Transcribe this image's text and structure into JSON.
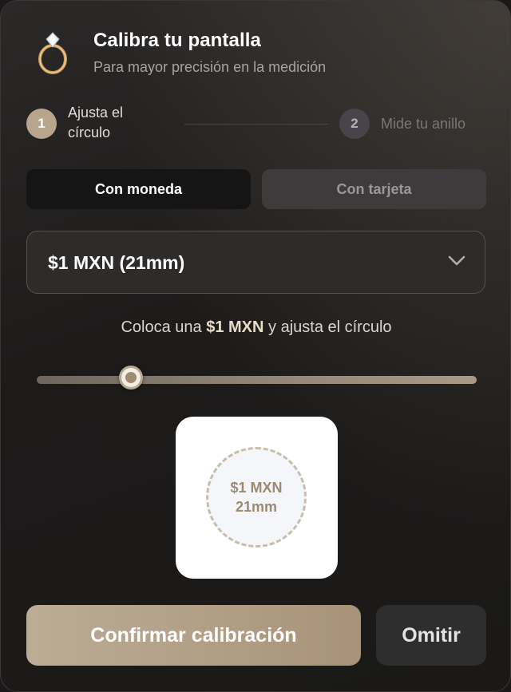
{
  "header": {
    "title": "Calibra tu pantalla",
    "subtitle": "Para mayor precisión en la medición",
    "icon": "ring-icon"
  },
  "steps": [
    {
      "number": "1",
      "label": "Ajusta el círculo",
      "state": "active"
    },
    {
      "number": "2",
      "label": "Mide tu anillo",
      "state": "inactive"
    }
  ],
  "tabs": [
    {
      "label": "Con moneda",
      "active": true
    },
    {
      "label": "Con tarjeta",
      "active": false
    }
  ],
  "coin_select": {
    "selected": "$1 MXN (21mm)",
    "icon": "chevron-down-icon"
  },
  "instruction": {
    "before": "Coloca una ",
    "highlight": "$1 MXN",
    "after": " y ajusta el círculo"
  },
  "slider": {
    "value_fraction": 0.215
  },
  "preview": {
    "coin_name": "$1 MXN",
    "coin_size": "21mm"
  },
  "actions": {
    "confirm_label": "Confirmar calibración",
    "skip_label": "Omitir"
  },
  "colors": {
    "accent": "#b9a58c",
    "background": "#1d1b1a",
    "coin_text": "#9d8a73"
  }
}
